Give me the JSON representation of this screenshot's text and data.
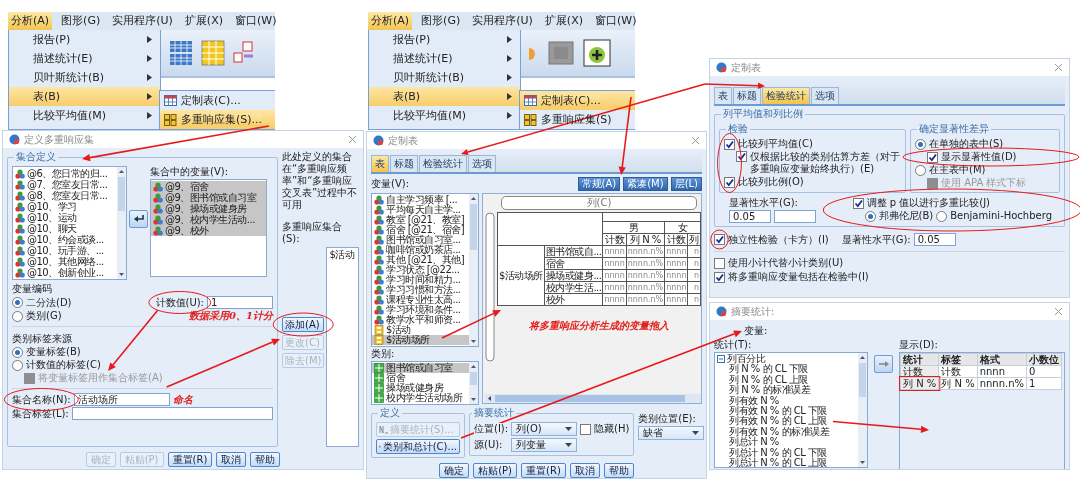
{
  "menu_windows": [
    {
      "kind": "grid-toolbar",
      "menubar": [
        {
          "label": "分析(A)",
          "selected": true
        },
        {
          "label": "图形(G)",
          "selected": false
        },
        {
          "label": "实用程序(U)",
          "selected": false
        },
        {
          "label": "扩展(X)",
          "selected": false
        },
        {
          "label": "窗口(W)",
          "selected": false
        }
      ],
      "menu": [
        {
          "label": "报告(P)",
          "selected": false
        },
        {
          "label": "描述统计(E)",
          "selected": false
        },
        {
          "label": "贝叶斯统计(B)",
          "selected": false
        },
        {
          "label": "表(B)",
          "selected": true
        },
        {
          "label": "比较平均值(M)",
          "selected": false
        }
      ],
      "submenu": [
        {
          "kind": "table",
          "label": "定制表(C)...",
          "selected": false
        },
        {
          "kind": "sets",
          "label": "多重响应集(S)...",
          "selected": true
        }
      ]
    },
    {
      "kind": "button-toolbar",
      "menubar": [
        {
          "label": "分析(A)",
          "selected": true
        },
        {
          "label": "图形(G)",
          "selected": false
        },
        {
          "label": "实用程序(U)",
          "selected": false
        },
        {
          "label": "扩展(X)",
          "selected": false
        },
        {
          "label": "窗口(W)",
          "selected": false
        }
      ],
      "menu": [
        {
          "label": "报告(P)",
          "selected": false
        },
        {
          "label": "描述统计(E)",
          "selected": false
        },
        {
          "label": "贝叶斯统计(B)",
          "selected": false
        },
        {
          "label": "表(B)",
          "selected": true
        },
        {
          "label": "比较平均值(M)",
          "selected": false
        }
      ],
      "submenu": [
        {
          "kind": "table",
          "label": "定制表(C)...",
          "selected": true
        },
        {
          "kind": "sets",
          "label": "多重响应集(S)",
          "selected": false
        }
      ]
    }
  ],
  "define_sets_dialog": {
    "title": "定义多重响应集",
    "group_title": "集合定义",
    "variables": [
      {
        "label": "@6、您日常的归...",
        "selected": false
      },
      {
        "label": "@7、您室友日常...",
        "selected": false
      },
      {
        "label": "@8、您室友日常...",
        "selected": false
      },
      {
        "label": "@10、学习",
        "selected": false
      },
      {
        "label": "@10、运动",
        "selected": false
      },
      {
        "label": "@10、聊天",
        "selected": false
      },
      {
        "label": "@10、约会或谈...",
        "selected": false
      },
      {
        "label": "@10、玩手游、...",
        "selected": false
      },
      {
        "label": "@10、其他网络...",
        "selected": false
      },
      {
        "label": "@10、创新创业...",
        "selected": false
      }
    ],
    "set_variables_label": "集合中的变量(V):",
    "set_variables": [
      {
        "label": "@9、宿舍",
        "selected": true
      },
      {
        "label": "@9、图书馆或自习室",
        "selected": true
      },
      {
        "label": "@9、操场或健身房",
        "selected": true
      },
      {
        "label": "@9、校内学生活动...",
        "selected": true
      },
      {
        "label": "@9、校外",
        "selected": true
      }
    ],
    "note": "此处定义的集合在“多重响应频率”和“多重响应交叉表”过程中不可用",
    "sets_label": "多重响应集合(S):",
    "sets": [
      "$活动"
    ],
    "coding_label": "变量编码",
    "coding": [
      {
        "label": "二分法(D)",
        "selected": true
      },
      {
        "label": "类别(G)",
        "selected": false
      }
    ],
    "counted_value_label": "计数值(U):",
    "counted_value": "1",
    "coding_annotation": "数据采用0、1计分",
    "label_source_label": "类别标签来源",
    "label_source": [
      {
        "label": "变量标签(B)",
        "selected": true
      },
      {
        "label": "计数值的标签(C)",
        "selected": false
      }
    ],
    "use_label_checkbox": {
      "label": "将变量标签用作集合标签(A)",
      "checked": false,
      "disabled": true
    },
    "set_name_label": "集合名称(N):",
    "set_name": "活动场所",
    "set_name_annotation": "命名",
    "set_label_label": "集合标签(L):",
    "side_buttons": [
      {
        "label": "添加(A)",
        "disabled": false
      },
      {
        "label": "更改(C)",
        "disabled": true
      },
      {
        "label": "除去(M)",
        "disabled": true
      }
    ],
    "buttons": [
      {
        "label": "确定",
        "disabled": true
      },
      {
        "label": "粘贴(P)",
        "disabled": true
      },
      {
        "label": "重置(R)",
        "disabled": false
      },
      {
        "label": "取消",
        "disabled": false
      },
      {
        "label": "帮助",
        "disabled": false
      }
    ]
  },
  "custom_tables_dialog": {
    "title": "定制表",
    "tabs": [
      {
        "label": "表",
        "selected": true
      },
      {
        "label": "标题",
        "selected": false
      },
      {
        "label": "检验统计",
        "selected": false
      },
      {
        "label": "选项",
        "selected": false
      }
    ],
    "variables_label": "变量(V):",
    "view_buttons": [
      "常规(A)",
      "紧凑(M)",
      "层(L)"
    ],
    "variables": [
      {
        "kind": "variable",
        "label": "自主学习频率 [...",
        "selected": false
      },
      {
        "kind": "variable",
        "label": "平均每天自主学...",
        "selected": false
      },
      {
        "kind": "variable",
        "label": "教室 [@21、教室]",
        "selected": false
      },
      {
        "kind": "variable",
        "label": "宿舍 [@21、宿舍]",
        "selected": false
      },
      {
        "kind": "variable",
        "label": "图书馆或自习室...",
        "selected": false
      },
      {
        "kind": "variable",
        "label": "咖啡馆或奶茶店...",
        "selected": false
      },
      {
        "kind": "variable",
        "label": "其他 [@21、其他]",
        "selected": false
      },
      {
        "kind": "variable",
        "label": "学习状态 [@22...",
        "selected": false
      },
      {
        "kind": "variable",
        "label": "学习时间和精力...",
        "selected": false
      },
      {
        "kind": "variable",
        "label": "学习习惯和方法...",
        "selected": false
      },
      {
        "kind": "variable",
        "label": "课程专业性太高...",
        "selected": false
      },
      {
        "kind": "variable",
        "label": "学习环境和条件...",
        "selected": false
      },
      {
        "kind": "variable",
        "label": "教学水平和师资...",
        "selected": false
      },
      {
        "kind": "set",
        "label": "$活动",
        "selected": false
      },
      {
        "kind": "set",
        "label": "$活动场所",
        "selected": true
      }
    ],
    "categories_label": "类别:",
    "categories": [
      {
        "label": "图书馆或自习室",
        "selected": true
      },
      {
        "label": "宿舍",
        "selected": false
      },
      {
        "label": "操场或健身房",
        "selected": false
      },
      {
        "label": "校内学生活动场所",
        "selected": false
      }
    ],
    "canvas": {
      "column_zone": "列(C)",
      "column_groups": [
        "男",
        "女"
      ],
      "columns": [
        "计数",
        "列 N %",
        "计数",
        "列"
      ],
      "row_group": "$活动场所",
      "rows": [
        {
          "label": "图书馆或自...",
          "cells": [
            "nnnn",
            "nnnn.n%",
            "nnnn",
            "n"
          ]
        },
        {
          "label": "宿舍",
          "cells": [
            "nnnn",
            "nnnn.n%",
            "nnnn",
            "n"
          ]
        },
        {
          "label": "操场或健身...",
          "cells": [
            "nnnn",
            "nnnn.n%",
            "nnnn",
            "n"
          ]
        },
        {
          "label": "校内学生活...",
          "cells": [
            "nnnn",
            "nnnn.n%",
            "nnnn",
            "n"
          ]
        },
        {
          "label": "校外",
          "cells": [
            "nnnn",
            "nnnn.n%",
            "nnnn",
            "n"
          ]
        }
      ],
      "annotation": "将多重响应分析生成的变量拖入"
    },
    "define_group": {
      "title": "定义",
      "buttons": [
        {
          "label": "摘要统计(S)...",
          "disabled": true
        },
        {
          "label": "类别和总计(C)...",
          "disabled": false
        }
      ]
    },
    "summary_group": {
      "title": "摘要统计",
      "position_label": "位置(I):",
      "position": "列(O)",
      "hide": {
        "label": "隐藏(H)",
        "checked": false
      },
      "source_label": "源(U):",
      "source": "列变量"
    },
    "category_position_label": "类别位置(E):",
    "category_position": "缺省",
    "buttons": [
      "确定",
      "粘贴(P)",
      "重置(R)",
      "取消",
      "帮助"
    ]
  },
  "test_statistics_dialog": {
    "title": "定制表",
    "tabs": [
      {
        "label": "表",
        "selected": false
      },
      {
        "label": "标题",
        "selected": false
      },
      {
        "label": "检验统计",
        "selected": true
      },
      {
        "label": "选项",
        "selected": false
      }
    ],
    "group_title": "列平均值和列比例",
    "tests_title": "检验",
    "tests": [
      {
        "label": "比较列平均值(C)",
        "checked": true,
        "children": [
          {
            "label": "仅根据比较的类别估算方差（对于多重响应变量始终执行）(E)",
            "checked": true
          }
        ]
      },
      {
        "label": "比较列比例(O)",
        "checked": true
      }
    ],
    "significance_title": "确定显著性差异",
    "significance": [
      {
        "label": "在单独的表中(S)",
        "selected": true,
        "children": [
          {
            "label": "显示显著性值(D)",
            "checked": true,
            "disabled": false
          }
        ]
      },
      {
        "label": "在主表中(M)",
        "selected": false,
        "children": [
          {
            "label": "使用 APA 样式下标",
            "checked": false,
            "disabled": true
          }
        ]
      }
    ],
    "level_label": "显著性水平(G):",
    "level_value": "0.05",
    "adjust": {
      "label": "调整 p 值以进行多重比较(J)",
      "checked": true
    },
    "adjust_methods": [
      {
        "label": "邦弗伦尼(B)",
        "selected": true
      },
      {
        "label": "Benjamini-Hochberg",
        "selected": false
      }
    ],
    "independence": {
      "label": "独立性检验（卡方）(I)",
      "checked": true
    },
    "independence_level_label": "显著性水平(G):",
    "independence_level": "0.05",
    "options": [
      {
        "label": "使用小计代替小计类别(U)",
        "checked": false
      },
      {
        "label": "将多重响应变量包括在检验中(I)",
        "checked": true
      }
    ]
  },
  "summary_statistics_dialog": {
    "title": "摘要统计:",
    "variables_label": "变量:",
    "stats_label": "统计(T):",
    "stats": [
      {
        "label": "列百分比",
        "expanded": true,
        "children": [
          {
            "label": "列 N % 的 CL 下限"
          },
          {
            "label": "列 N % 的 CL 上限"
          },
          {
            "label": "列 N % 的标准误差"
          },
          {
            "label": "列有效 N %"
          },
          {
            "label": "列有效 N % 的 CL 下限"
          },
          {
            "label": "列有效 N % 的 CL 上限"
          },
          {
            "label": "列有效 N % 的标准误差"
          },
          {
            "label": "列总计 N %"
          },
          {
            "label": "列总计 N % 的 CL 下限"
          },
          {
            "label": "列总计 N % 的 CL 上限"
          }
        ]
      }
    ],
    "display_label": "显示(D):",
    "display_columns": [
      "统计",
      "标签",
      "格式",
      "小数位"
    ],
    "display_rows": [
      [
        "计数",
        "计数",
        "nnnn",
        "0"
      ],
      [
        "列 N %",
        "列 N %",
        "nnnn.n%",
        "1"
      ]
    ]
  }
}
